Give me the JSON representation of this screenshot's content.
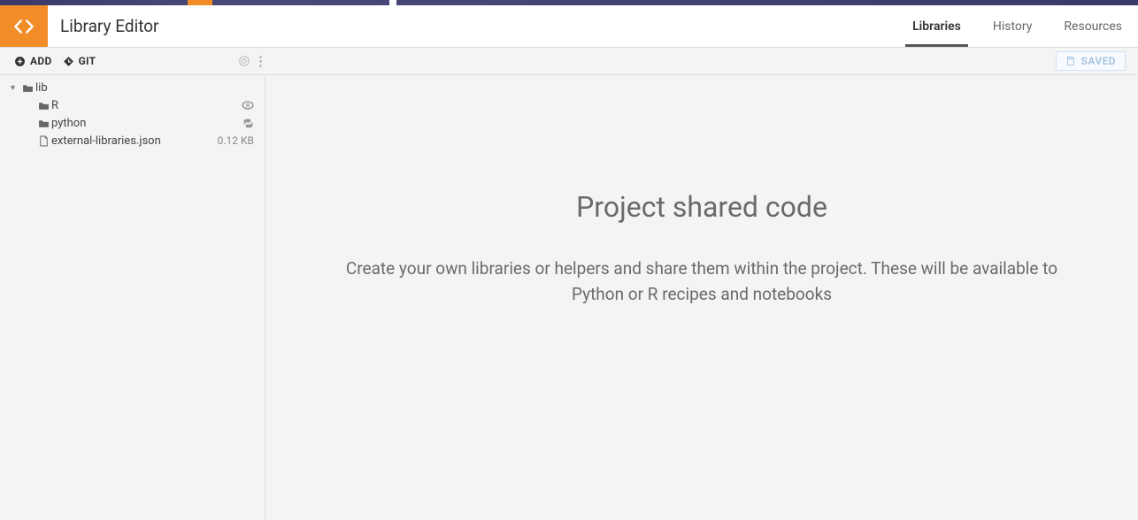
{
  "header": {
    "title": "Library Editor",
    "tabs": [
      {
        "label": "Libraries",
        "active": true
      },
      {
        "label": "History",
        "active": false
      },
      {
        "label": "Resources",
        "active": false
      }
    ]
  },
  "toolbar": {
    "add_label": "ADD",
    "git_label": "GIT",
    "saved_label": "SAVED"
  },
  "tree": {
    "root": {
      "label": "lib"
    },
    "items": [
      {
        "label": "R",
        "icon": "r-lang-icon",
        "type": "folder"
      },
      {
        "label": "python",
        "icon": "python-icon",
        "type": "folder"
      },
      {
        "label": "external-libraries.json",
        "icon": "file-icon",
        "type": "file",
        "size": "0.12 KB"
      }
    ]
  },
  "main": {
    "title": "Project shared code",
    "description": "Create your own libraries or helpers and share them within the project. These will be available to Python or R recipes and notebooks"
  }
}
